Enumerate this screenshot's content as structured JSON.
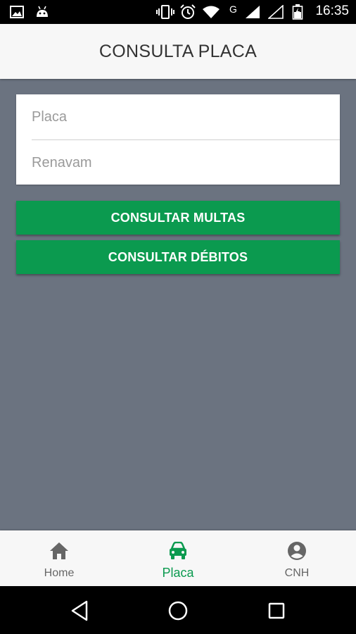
{
  "status_bar": {
    "time": "16:35",
    "network_label": "G",
    "icons": [
      "image-icon",
      "android-icon",
      "vibrate-icon",
      "alarm-icon",
      "wifi-icon",
      "signal-icon",
      "signal-empty-icon",
      "battery-icon"
    ]
  },
  "app_bar": {
    "title": "CONSULTA PLACA"
  },
  "form": {
    "placa": {
      "placeholder": "Placa",
      "value": ""
    },
    "renavam": {
      "placeholder": "Renavam",
      "value": ""
    }
  },
  "buttons": {
    "consultar_multas": "CONSULTAR MULTAS",
    "consultar_debitos": "CONSULTAR DÉBITOS"
  },
  "bottom_nav": {
    "items": [
      {
        "label": "Home",
        "icon": "home-icon",
        "active": false
      },
      {
        "label": "Placa",
        "icon": "car-icon",
        "active": true
      },
      {
        "label": "CNH",
        "icon": "account-circle-icon",
        "active": false
      }
    ]
  },
  "colors": {
    "accent": "#0b9a4f",
    "background": "#6b7380",
    "app_bar": "#f7f7f7",
    "inactive_nav": "#666666"
  }
}
